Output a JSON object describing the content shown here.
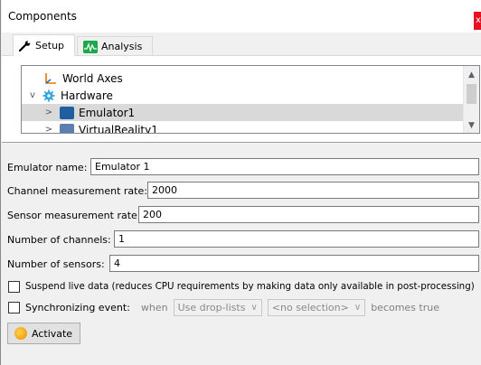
{
  "window": {
    "title": "Components",
    "close_glyph": "x"
  },
  "tabs": [
    {
      "label": "Setup",
      "icon": "wrench-icon",
      "active": true
    },
    {
      "label": "Analysis",
      "icon": "analysis-icon",
      "active": false
    }
  ],
  "tree": {
    "items": [
      {
        "label": "World Axes",
        "icon": "axes-icon",
        "level": 1,
        "expander": ""
      },
      {
        "label": "Hardware",
        "icon": "gear-icon",
        "level": 0,
        "expander": "v"
      },
      {
        "label": "Emulator1",
        "icon": "emulator-icon",
        "level": 1,
        "expander": ">",
        "selected": true
      },
      {
        "label": "VirtualReality1",
        "icon": "vr-icon",
        "level": 1,
        "expander": ">"
      }
    ]
  },
  "form": {
    "emulator_name_label": "Emulator name:",
    "emulator_name_value": "Emulator 1",
    "channel_rate_label": "Channel measurement rate:",
    "channel_rate_value": "2000",
    "sensor_rate_label": "Sensor measurement rate:",
    "sensor_rate_value": "200",
    "num_channels_label": "Number of channels:",
    "num_channels_value": "1",
    "num_sensors_label": "Number of sensors:",
    "num_sensors_value": "4",
    "suspend_label": "Suspend live data (reduces CPU requirements by making data only available in post-processing)",
    "sync_label": "Synchronizing event:",
    "sync_when": "when",
    "sync_dropdown1": "Use drop-lists",
    "sync_dropdown2": "<no selection>",
    "sync_suffix": "becomes true",
    "activate_label": "Activate"
  },
  "colors": {
    "close": "#e81123",
    "selection": "#d9d9d9",
    "analysis_icon": "#1aa84a"
  }
}
